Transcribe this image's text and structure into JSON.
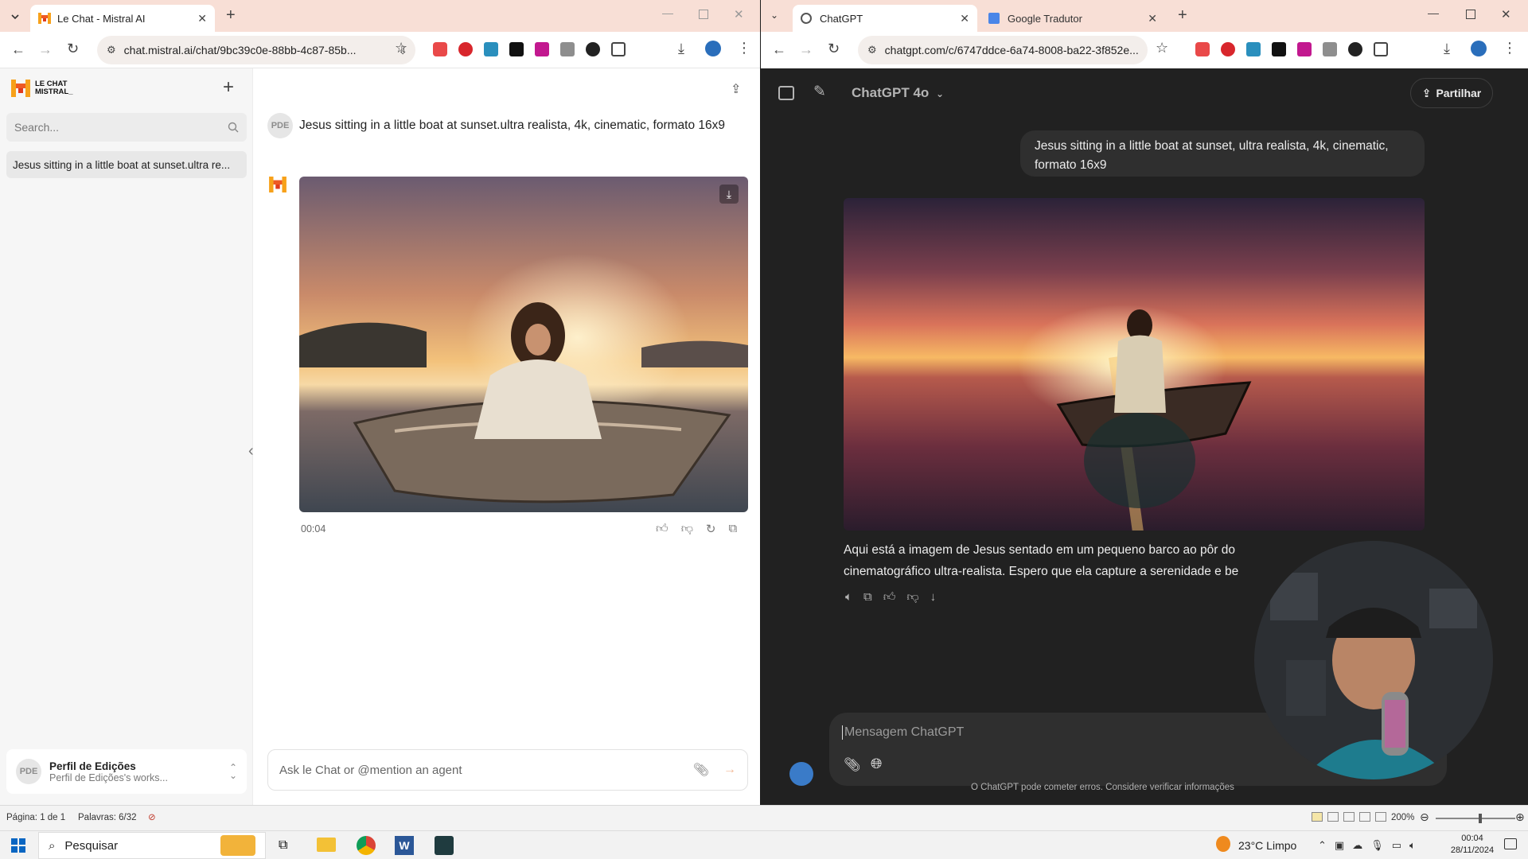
{
  "left_window": {
    "tab_title": "Le Chat - Mistral AI",
    "url": "chat.mistral.ai/chat/9bc39c0e-88bb-4c87-85b...",
    "brand": {
      "line1": "LE CHAT",
      "line2": "MISTRAL_"
    },
    "search_placeholder": "Search...",
    "history": [
      "Jesus sitting in a little boat at sunset.ultra re..."
    ],
    "user_initials": "PDE",
    "prompt": "Jesus sitting in a little boat at sunset.ultra realista, 4k, cinematic, formato 16x9",
    "timestamp": "00:04",
    "input_placeholder": "Ask le Chat or @mention an agent",
    "profile": {
      "name": "Perfil de Edições",
      "sub": "Perfil de Edições's works..."
    }
  },
  "right_window": {
    "tabs": [
      {
        "title": "ChatGPT"
      },
      {
        "title": "Google Tradutor"
      }
    ],
    "url": "chatgpt.com/c/6747ddce-6a74-8008-ba22-3f852e...",
    "model": "ChatGPT 4o",
    "share_label": "Partilhar",
    "user_message": "Jesus sitting in a little boat at sunset, ultra realista, 4k, cinematic, formato 16x9",
    "reply_line1": "Aqui está a imagem de Jesus sentado em um pequeno barco ao pôr do",
    "reply_line2": "cinematográfico ultra-realista. Espero que ela capture a serenidade e be",
    "composer_placeholder": "Mensagem ChatGPT",
    "disclaimer": "O ChatGPT pode cometer erros. Considere verificar informações"
  },
  "word_status": {
    "page": "Página: 1 de 1",
    "words": "Palavras: 6/32",
    "zoom": "200%"
  },
  "taskbar": {
    "search_label": "Pesquisar",
    "weather": "23°C  Limpo",
    "time": "00:04",
    "date": "28/11/2024"
  },
  "colors": {
    "mistral_orange": "#f26a1b",
    "chrome_tabstrip": "#f8dfd6",
    "gpt_bg": "#212121"
  }
}
